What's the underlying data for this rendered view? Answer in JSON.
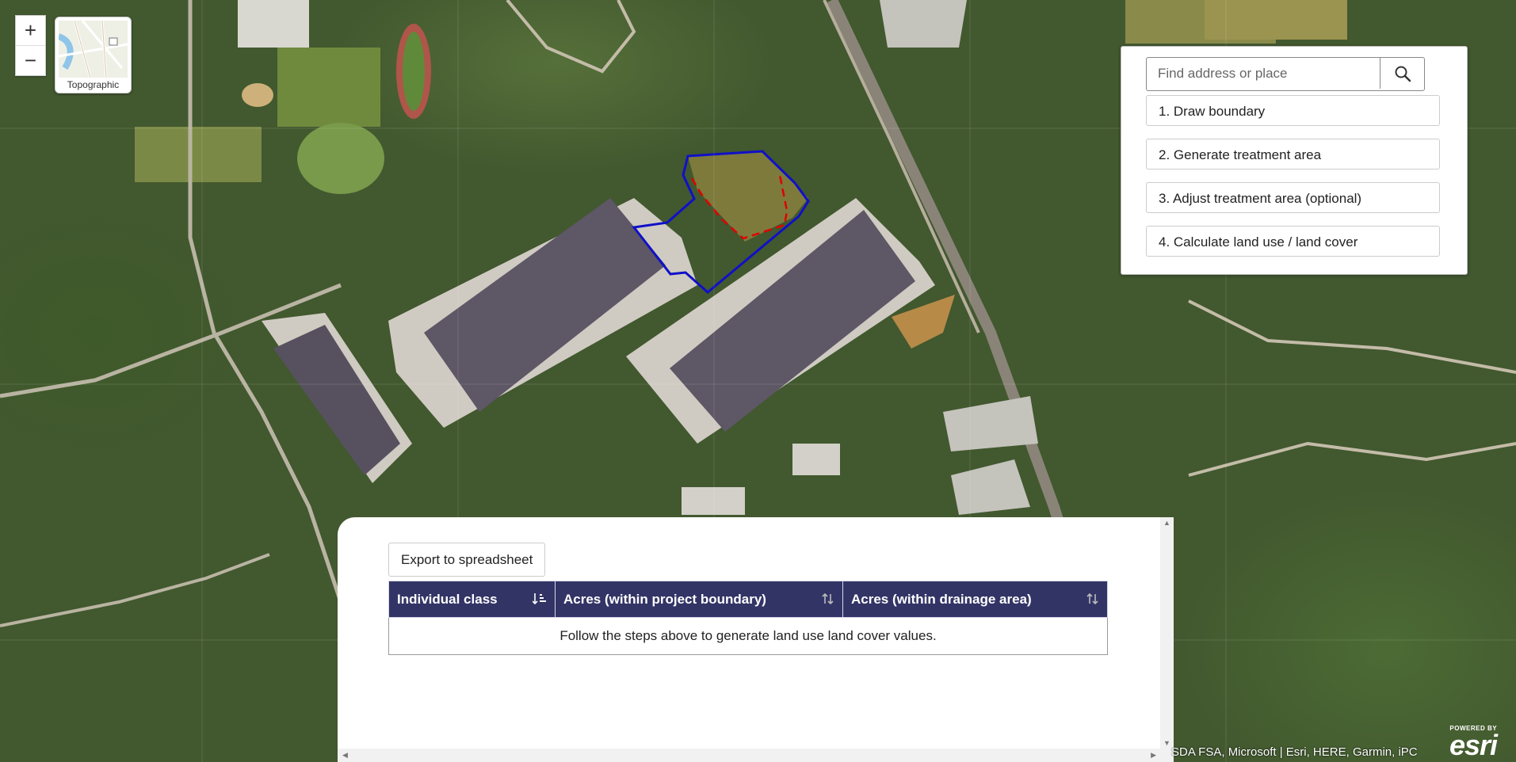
{
  "zoom": {
    "in_label": "+",
    "out_label": "−"
  },
  "basemap": {
    "label": "Topographic"
  },
  "search": {
    "placeholder": "Find address or place"
  },
  "steps": [
    "1. Draw boundary",
    "2. Generate treatment area",
    "3. Adjust treatment area (optional)",
    "4. Calculate land use / land cover"
  ],
  "results": {
    "export_label": "Export to spreadsheet",
    "columns": [
      "Individual class",
      "Acres (within project boundary)",
      "Acres (within drainage area)"
    ],
    "empty_message": "Follow the steps above to generate land use land cover values."
  },
  "attribution": "SDA FSA, Microsoft | Esri, HERE, Garmin, iPC",
  "esri_logo": {
    "powered": "POWERED BY",
    "brand": "esri"
  },
  "colors": {
    "header": "#333466",
    "project_boundary": "#1010c8",
    "treatment_area": "#e00000"
  }
}
